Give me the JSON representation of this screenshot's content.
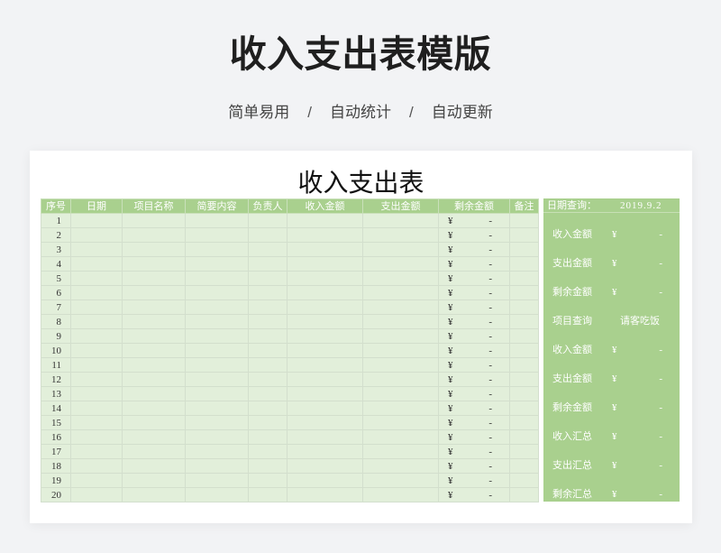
{
  "page": {
    "title": "收入支出表模版",
    "features": [
      "简单易用",
      "自动统计",
      "自动更新"
    ],
    "feature_separator": "/"
  },
  "ledger": {
    "title": "收入支出表",
    "columns": [
      "序号",
      "日期",
      "项目名称",
      "简要内容",
      "负责人",
      "收入金额",
      "支出金额",
      "剩余金额",
      "备注"
    ],
    "rows": [
      {
        "no": "1",
        "balance_currency": "¥",
        "balance": "-"
      },
      {
        "no": "2",
        "balance_currency": "¥",
        "balance": "-"
      },
      {
        "no": "3",
        "balance_currency": "¥",
        "balance": "-"
      },
      {
        "no": "4",
        "balance_currency": "¥",
        "balance": "-"
      },
      {
        "no": "5",
        "balance_currency": "¥",
        "balance": "-"
      },
      {
        "no": "6",
        "balance_currency": "¥",
        "balance": "-"
      },
      {
        "no": "7",
        "balance_currency": "¥",
        "balance": "-"
      },
      {
        "no": "8",
        "balance_currency": "¥",
        "balance": "-"
      },
      {
        "no": "9",
        "balance_currency": "¥",
        "balance": "-"
      },
      {
        "no": "10",
        "balance_currency": "¥",
        "balance": "-"
      },
      {
        "no": "11",
        "balance_currency": "¥",
        "balance": "-"
      },
      {
        "no": "12",
        "balance_currency": "¥",
        "balance": "-"
      },
      {
        "no": "13",
        "balance_currency": "¥",
        "balance": "-"
      },
      {
        "no": "14",
        "balance_currency": "¥",
        "balance": "-"
      },
      {
        "no": "15",
        "balance_currency": "¥",
        "balance": "-"
      },
      {
        "no": "16",
        "balance_currency": "¥",
        "balance": "-"
      },
      {
        "no": "17",
        "balance_currency": "¥",
        "balance": "-"
      },
      {
        "no": "18",
        "balance_currency": "¥",
        "balance": "-"
      },
      {
        "no": "19",
        "balance_currency": "¥",
        "balance": "-"
      },
      {
        "no": "20",
        "balance_currency": "¥",
        "balance": "-"
      }
    ]
  },
  "query_panel": {
    "date_query": {
      "label": "日期查询：",
      "value": "2019.9.2"
    },
    "date_results": [
      {
        "label": "收入金额",
        "currency": "¥",
        "value": "-"
      },
      {
        "label": "支出金额",
        "currency": "¥",
        "value": "-"
      },
      {
        "label": "剩余金额",
        "currency": "¥",
        "value": "-"
      }
    ],
    "item_query": {
      "label": "项目查询",
      "value": "请客吃饭"
    },
    "item_results": [
      {
        "label": "收入金额",
        "currency": "¥",
        "value": "-"
      },
      {
        "label": "支出金额",
        "currency": "¥",
        "value": "-"
      },
      {
        "label": "剩余金额",
        "currency": "¥",
        "value": "-"
      }
    ],
    "totals": [
      {
        "label": "收入汇总",
        "currency": "¥",
        "value": "-"
      },
      {
        "label": "支出汇总",
        "currency": "¥",
        "value": "-"
      },
      {
        "label": "剩余汇总",
        "currency": "¥",
        "value": "-"
      }
    ]
  },
  "colors": {
    "page_background": "#f2f3f5",
    "card_background": "#ffffff",
    "header_green": "#a9d08e",
    "row_green": "#e2efda",
    "panel_green": "#a9d08e",
    "grid_line": "#d3dfcd"
  }
}
